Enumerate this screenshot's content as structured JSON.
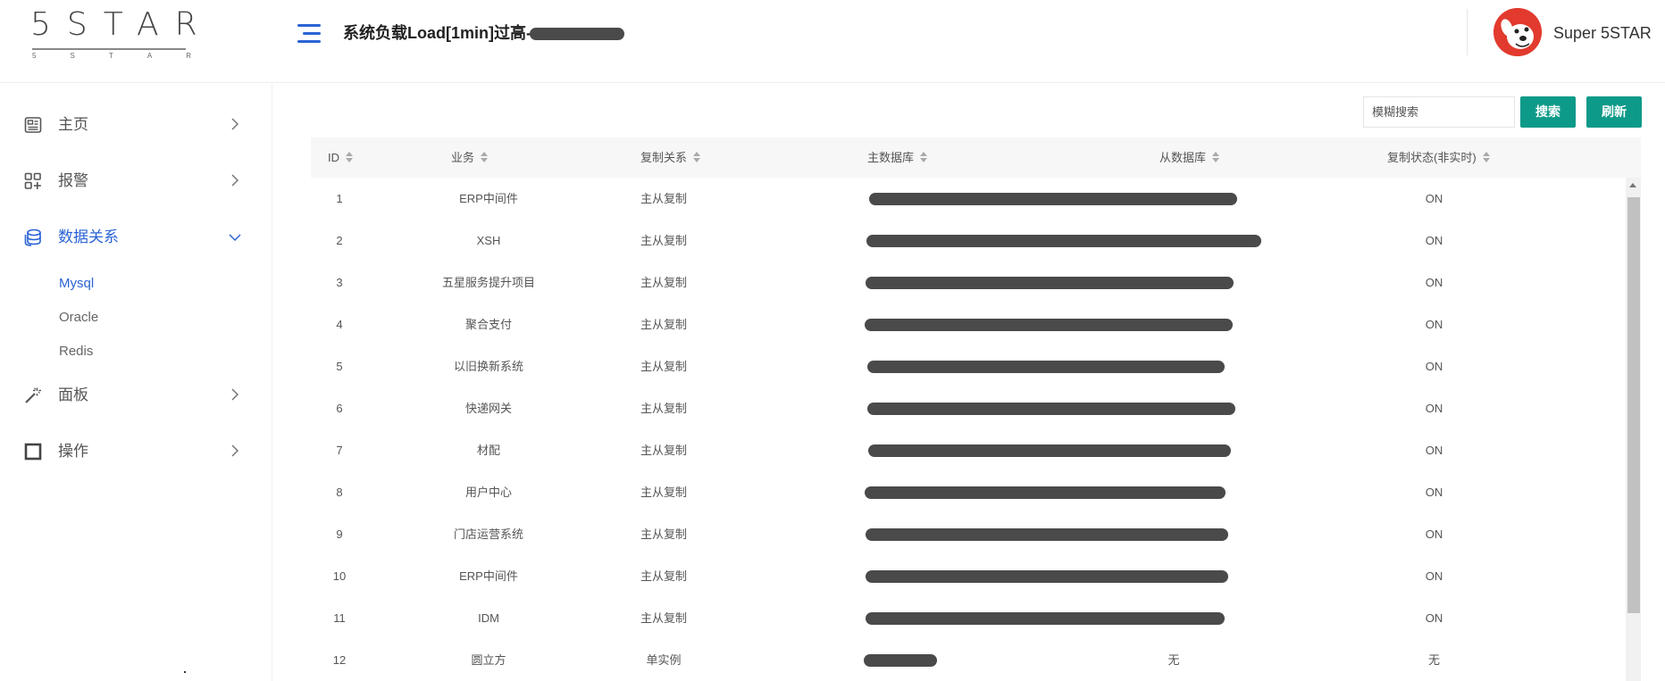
{
  "header": {
    "logo_text": "5STAR",
    "logo_sub": [
      "5",
      "S",
      "T",
      "A",
      "R"
    ],
    "alert_title": "系统负载Load[1min]过高-",
    "user_name": "Super 5STAR"
  },
  "sidebar": {
    "items": [
      {
        "label": "主页",
        "icon": "dashboard-icon"
      },
      {
        "label": "报警",
        "icon": "apps-icon"
      },
      {
        "label": "数据关系",
        "icon": "database-icon"
      },
      {
        "label": "面板",
        "icon": "magic-wand-icon"
      },
      {
        "label": "操作",
        "icon": "square-icon"
      }
    ],
    "sub_items": [
      "Mysql",
      "Oracle",
      "Redis"
    ],
    "active_item": "数据关系",
    "active_sub": "Mysql"
  },
  "toolbar": {
    "search_placeholder": "模糊搜索",
    "search_button": "搜索",
    "refresh_button": "刷新"
  },
  "table": {
    "columns": [
      "ID",
      "业务",
      "复制关系",
      "主数据库",
      "从数据库",
      "复制状态(非实时)"
    ],
    "rows": [
      {
        "id": "1",
        "biz": "ERP中间件",
        "rel": "主从复制",
        "master": "",
        "slave": "",
        "status": "ON"
      },
      {
        "id": "2",
        "biz": "XSH",
        "rel": "主从复制",
        "master": "",
        "slave": "",
        "status": "ON"
      },
      {
        "id": "3",
        "biz": "五星服务提升项目",
        "rel": "主从复制",
        "master": "",
        "slave": "",
        "status": "ON"
      },
      {
        "id": "4",
        "biz": "聚合支付",
        "rel": "主从复制",
        "master": "",
        "slave": "",
        "status": "ON"
      },
      {
        "id": "5",
        "biz": "以旧换新系统",
        "rel": "主从复制",
        "master": "",
        "slave": "",
        "status": "ON"
      },
      {
        "id": "6",
        "biz": "快递网关",
        "rel": "主从复制",
        "master": "",
        "slave": "",
        "status": "ON"
      },
      {
        "id": "7",
        "biz": "材配",
        "rel": "主从复制",
        "master": "",
        "slave": "",
        "status": "ON"
      },
      {
        "id": "8",
        "biz": "用户中心",
        "rel": "主从复制",
        "master": "",
        "slave": "",
        "status": "ON"
      },
      {
        "id": "9",
        "biz": "门店运营系统",
        "rel": "主从复制",
        "master": "",
        "slave": "",
        "status": "ON"
      },
      {
        "id": "10",
        "biz": "ERP中间件",
        "rel": "主从复制",
        "master": "",
        "slave": "",
        "status": "ON"
      },
      {
        "id": "11",
        "biz": "IDM",
        "rel": "主从复制",
        "master": "",
        "slave": "",
        "status": "ON"
      },
      {
        "id": "12",
        "biz": "圆立方",
        "rel": "单实例",
        "master": "",
        "slave": "无",
        "status": "无"
      }
    ]
  },
  "colors": {
    "accent": "#2a63d4",
    "button": "#0e9a89",
    "redaction": "#4a4a4a",
    "avatar": "#e23a2e"
  }
}
